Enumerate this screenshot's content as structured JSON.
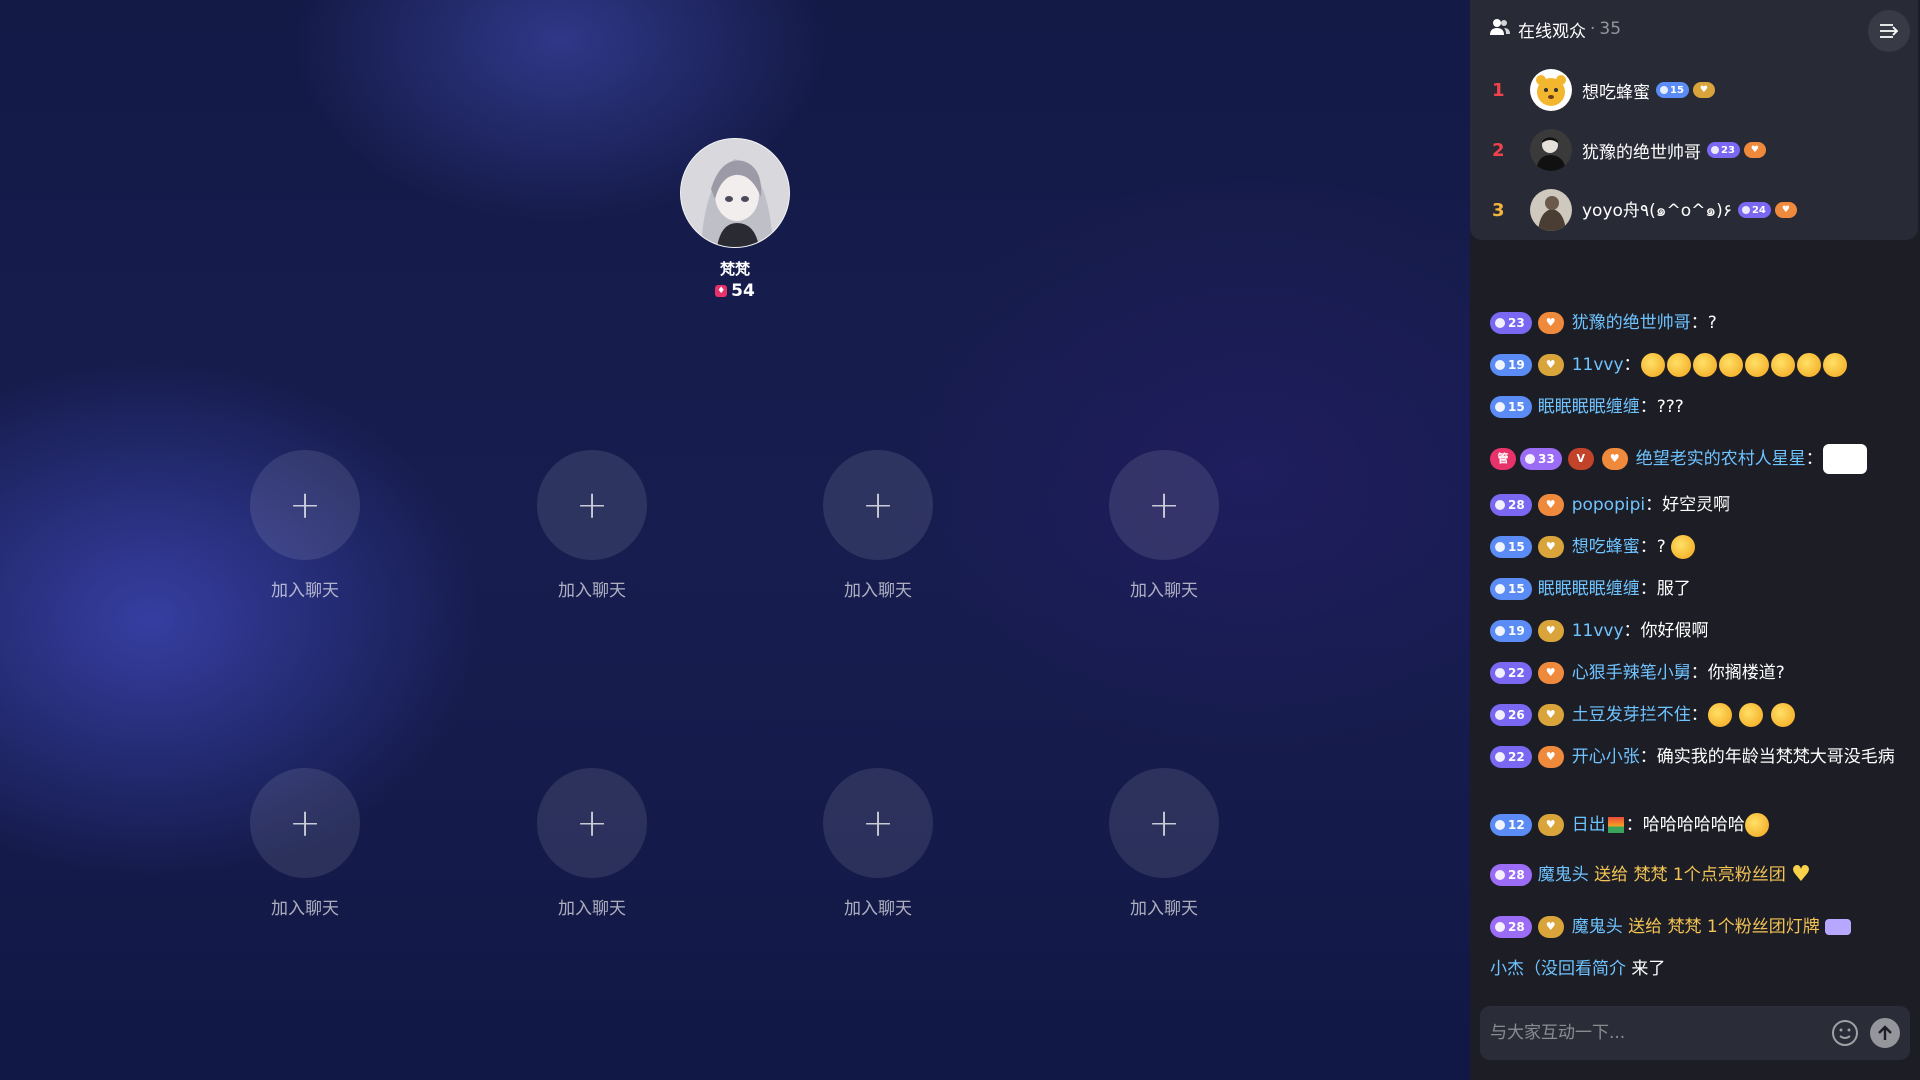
{
  "host": {
    "name": "梵梵",
    "score": "54"
  },
  "seat_label": "加入聊天",
  "seat_plus": "+",
  "audience": {
    "title": "在线观众",
    "separator": "·",
    "count": "35",
    "list": [
      {
        "rank": "1",
        "rank_color": "#f0424b",
        "name": "想吃蜂蜜",
        "level": "15",
        "level_color": "#5b8cf5",
        "fan_color": "#d9a43a"
      },
      {
        "rank": "2",
        "rank_color": "#f0424b",
        "name": "犹豫的绝世帅哥",
        "level": "23",
        "level_color": "#7a68f2",
        "fan_color": "#ef8a3c"
      },
      {
        "rank": "3",
        "rank_color": "#f5b43a",
        "name": "yoyo舟٩(๑^o^๑)۶",
        "level": "24",
        "level_color": "#7a68f2",
        "fan_color": "#ef8a3c"
      }
    ]
  },
  "chat": [
    {
      "level": "23",
      "user": "犹豫的绝世帅哥",
      "sep": "：",
      "text": "?"
    },
    {
      "level": "19",
      "user": "11vvy",
      "sep": "：",
      "text": ""
    },
    {
      "level": "15",
      "user": "眠眠眠眠缠缠",
      "sep": "：",
      "text": "???"
    },
    {
      "level": "33",
      "user": "绝望老实的农村人星星",
      "sep": "：",
      "text": ""
    },
    {
      "level": "28",
      "user": "popopipi",
      "sep": "：",
      "text": "好空灵啊"
    },
    {
      "level": "15",
      "user": "想吃蜂蜜",
      "sep": "：",
      "text": "?"
    },
    {
      "level": "15",
      "user": "眠眠眠眠缠缠",
      "sep": "：",
      "text": "服了"
    },
    {
      "level": "19",
      "user": "11vvy",
      "sep": "：",
      "text": "你好假啊"
    },
    {
      "level": "22",
      "user": "心狠手辣笔小舅",
      "sep": "：",
      "text": "你搁楼道?"
    },
    {
      "level": "26",
      "user": "土豆发芽拦不住",
      "sep": "：",
      "text": ""
    },
    {
      "level": "22",
      "user": "开心小张",
      "sep": "：",
      "text": "确实我的年龄当梵梵大哥没毛病"
    },
    {
      "level": "12",
      "user": "日出",
      "sep": "：",
      "text": "哈哈哈哈哈哈"
    },
    {
      "level": "28",
      "user": "魔鬼头",
      "gift_prefix": "送给",
      "gift_target": "梵梵",
      "gift": "1个点亮粉丝团"
    },
    {
      "level": "28",
      "user": "魔鬼头",
      "gift_prefix": "送给",
      "gift_target": "梵梵",
      "gift": "1个粉丝团灯牌"
    },
    {
      "user": "小杰（没回看简介",
      "text": "来了"
    }
  ],
  "input": {
    "placeholder": "与大家互动一下..."
  },
  "icons": {
    "people": "people-icon",
    "collapse": "collapse-panel-icon",
    "emoji": "emoji-icon",
    "send": "send-arrow-icon",
    "score": "gift-score-icon"
  },
  "colors": {
    "sidebar_bg": "#1c1d25",
    "card_bg": "#282a36",
    "username": "#6fc3ff",
    "gift_text": "#f3c354",
    "stage_bg": "#161c4c"
  }
}
